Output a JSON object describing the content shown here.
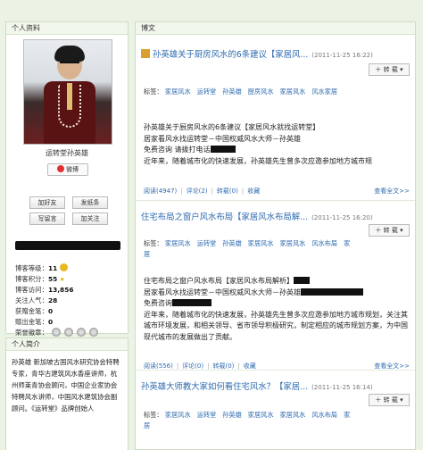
{
  "sidebar": {
    "profile_header": "个人资料",
    "nickname": "运转堂孙英雄",
    "weibo_label": "微博",
    "buttons": {
      "add_friend": "加好友",
      "message": "发纸条",
      "write_msg": "写留言",
      "follow": "加关注"
    },
    "stats": [
      {
        "label": "博客等级：",
        "value": "11"
      },
      {
        "label": "博客积分：",
        "value": "55"
      },
      {
        "label": "博客访问：",
        "value": "13,856"
      },
      {
        "label": "关注人气：",
        "value": "28"
      },
      {
        "label": "获赠金笔：",
        "value": "0"
      },
      {
        "label": "赠出金笔：",
        "value": "0"
      },
      {
        "label": "荣誉徽章：",
        "value": ""
      }
    ],
    "intro_header": "个人简介",
    "intro_text": "孙英雄 新加坡古国风水研究协会特聘专家，青华古建筑风水香座讲师，杭州师莱青协会顾问，中国企业家协会特聘风水讲师，中国风水建筑协会副顾问。《运转堂》品牌创始人"
  },
  "main": {
    "header": "博文",
    "repost_label": "转 载",
    "tags_label": "标签：",
    "more_label": "查看全文>>",
    "posts": [
      {
        "title": "孙英雄关于厨房风水的6条建议【家居风...",
        "date": "(2011-11-25 16:22)",
        "tags": [
          "家居风水",
          "运转堂",
          "孙英雄",
          "厨房风水",
          "家居风水",
          "风水家居"
        ],
        "lines": [
          "孙英雄关于厨房风水的6条建议【家居风水就找运转堂】",
          "居家看风水找运转堂－中国权威风水大师－孙英雄",
          "免费咨询 请拨打电话",
          "近年来，随着城市化的快速发展，孙英雄先生曾多次应邀参加地方城市规"
        ],
        "reads": "阅读(4947)",
        "comments": "评论(2)",
        "reposts": "转载(0)",
        "collect": "收藏"
      },
      {
        "title": "住宅布局之窗户风水布局【家居风水布局解...",
        "date": "(2011-11-25 16:20)",
        "tags": [
          "家居风水",
          "运转堂",
          "孙英雄",
          "家居风水",
          "家居风水",
          "风水布局",
          "家居"
        ],
        "lines": [
          "住宅布局之窗户风水布局【家居风水布局解析】",
          "居家看风水找运转堂－中国权威风水大师－孙英雄",
          "免费咨询",
          "近年来，随着城市化的快速发展，孙英雄先生曾多次应邀参加地方城市规划，关注其城市环境发展，和相关领导、省市领导积极研究，制定相应的城市规划方案，为中国现代城市的发展做出了贡献。"
        ],
        "reads": "阅读(556)",
        "comments": "评论(0)",
        "reposts": "转载(0)",
        "collect": "收藏"
      },
      {
        "title": "孙英雄大师教大家如何看住宅风水？【家居...",
        "date": "(2011-11-25 16:14)",
        "tags": [
          "家居风水",
          "运转堂",
          "孙英雄",
          "家居风水",
          "家居风水",
          "风水布局",
          "家居"
        ],
        "lines": [],
        "reads": "",
        "comments": "",
        "reposts": "",
        "collect": ""
      }
    ]
  }
}
